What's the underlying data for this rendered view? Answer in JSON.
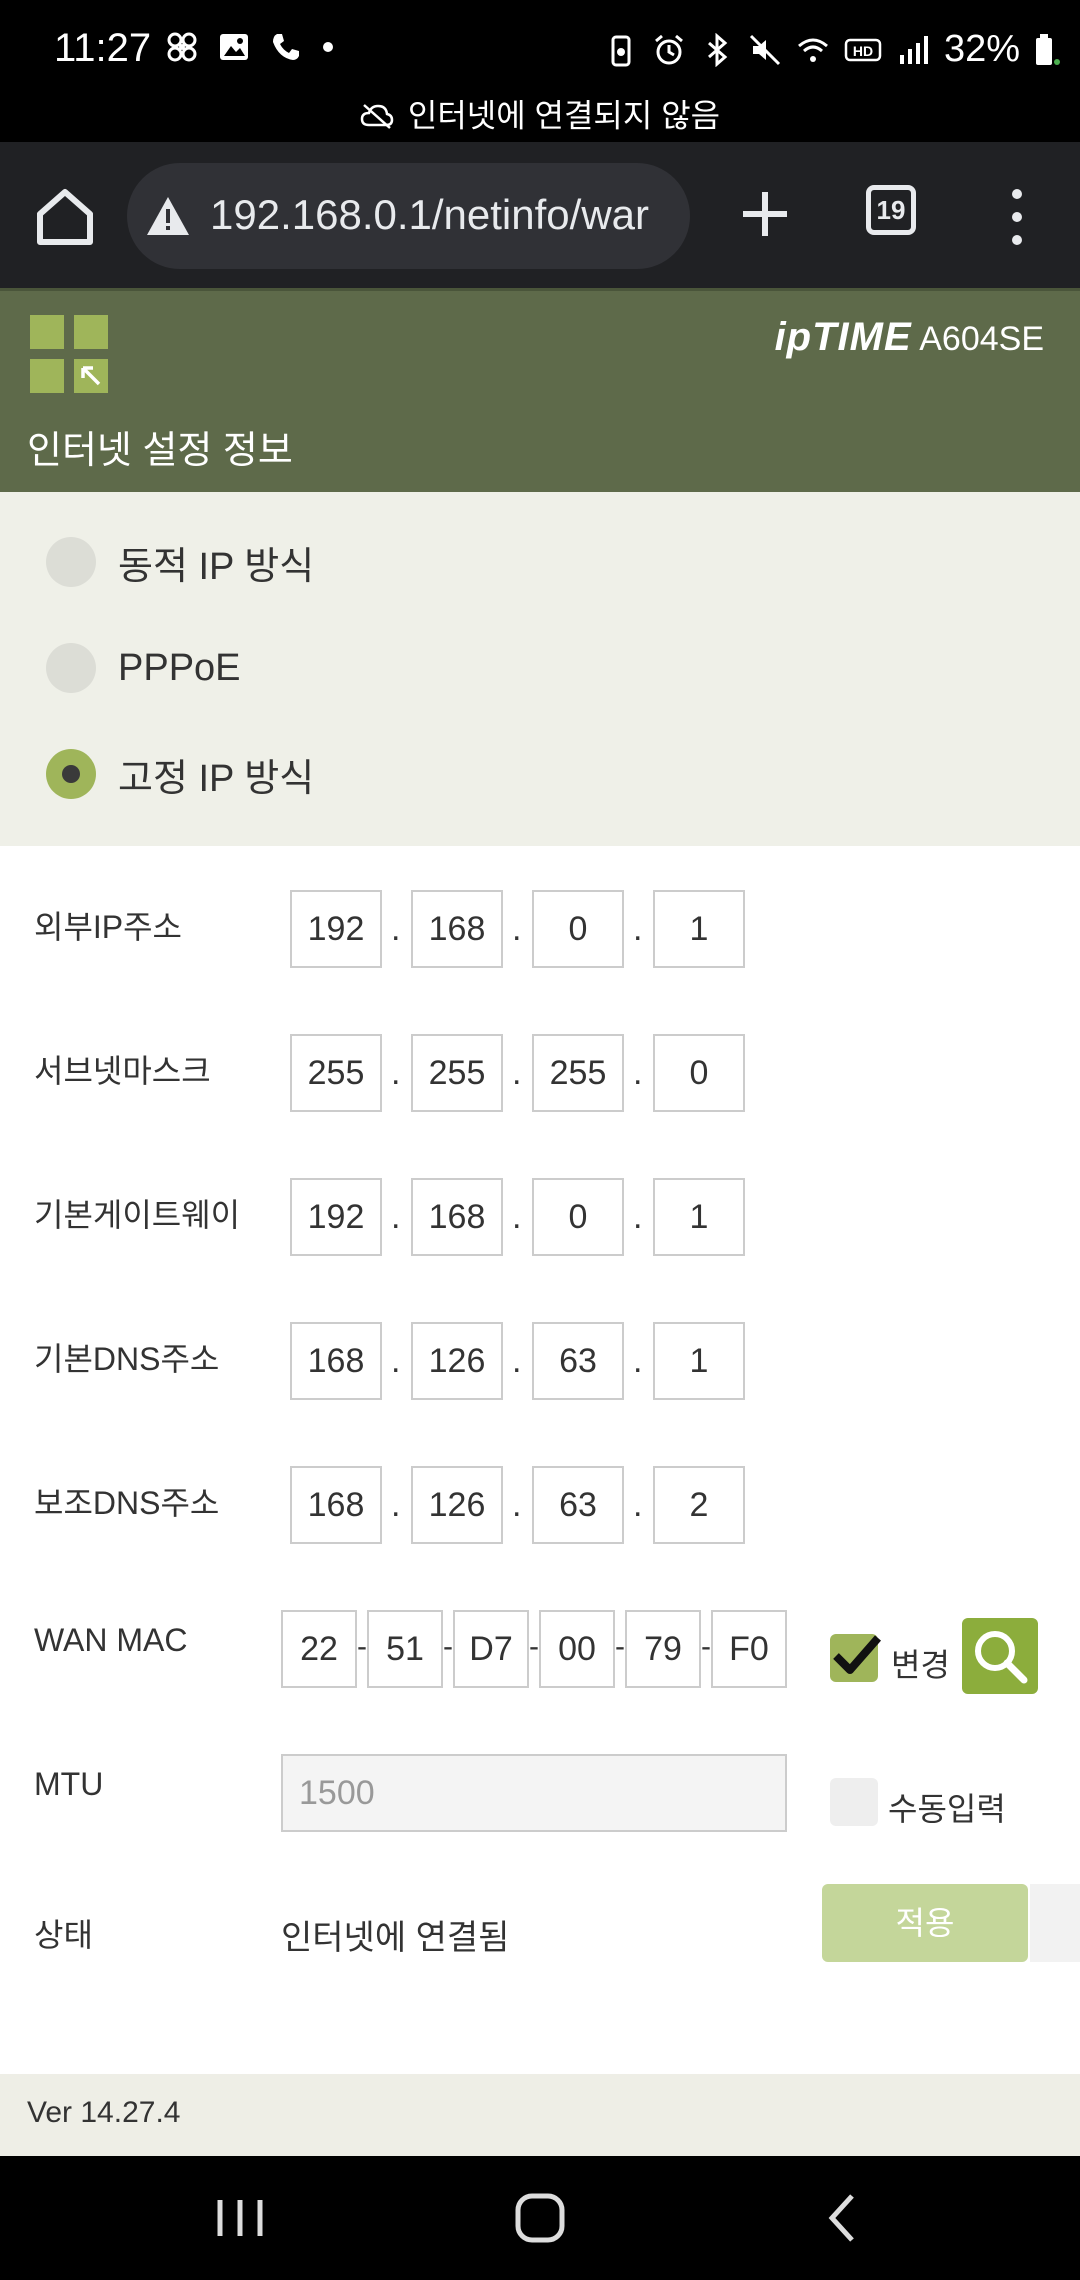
{
  "status_bar": {
    "time": "11:27",
    "battery": "32%",
    "left_icons": [
      "fan-icon",
      "image-icon",
      "phone-icon",
      "dot-icon"
    ],
    "right_icons": [
      "battery-saver-icon",
      "alarm-icon",
      "bluetooth-icon",
      "mute-icon",
      "wifi-icon",
      "hd-icon",
      "signal-icon",
      "battery-icon"
    ],
    "notice": "인터넷에 연결되지 않음"
  },
  "browser": {
    "url": "192.168.0.1/netinfo/war",
    "tab_count": "19"
  },
  "router": {
    "brand": "ipTIME",
    "model": "A604SE",
    "page_title": "인터넷 설정 정보"
  },
  "connection_types": [
    {
      "label": "동적 IP 방식",
      "selected": false
    },
    {
      "label": "PPPoE",
      "selected": false
    },
    {
      "label": "고정 IP 방식",
      "selected": true
    }
  ],
  "form": {
    "external_ip": {
      "label": "외부IP주소",
      "octets": [
        "192",
        "168",
        "0",
        "1"
      ]
    },
    "subnet_mask": {
      "label": "서브넷마스크",
      "octets": [
        "255",
        "255",
        "255",
        "0"
      ]
    },
    "gateway": {
      "label": "기본게이트웨이",
      "octets": [
        "192",
        "168",
        "0",
        "1"
      ]
    },
    "dns_primary": {
      "label": "기본DNS주소",
      "octets": [
        "168",
        "126",
        "63",
        "1"
      ]
    },
    "dns_secondary": {
      "label": "보조DNS주소",
      "octets": [
        "168",
        "126",
        "63",
        "2"
      ]
    },
    "wan_mac": {
      "label": "WAN MAC",
      "parts": [
        "22",
        "51",
        "D7",
        "00",
        "79",
        "F0"
      ],
      "change_label": "변경",
      "change_checked": true
    },
    "mtu": {
      "label": "MTU",
      "placeholder": "1500",
      "manual_label": "수동입력",
      "manual_checked": false
    },
    "status": {
      "label": "상태",
      "value": "인터넷에 연결됨"
    },
    "apply_label": "적용"
  },
  "footer": {
    "version": "Ver 14.27.4"
  },
  "colors": {
    "header_bg": "#5e6a4a",
    "accent": "#9fb55a",
    "panel_bg": "#eff0e8"
  }
}
